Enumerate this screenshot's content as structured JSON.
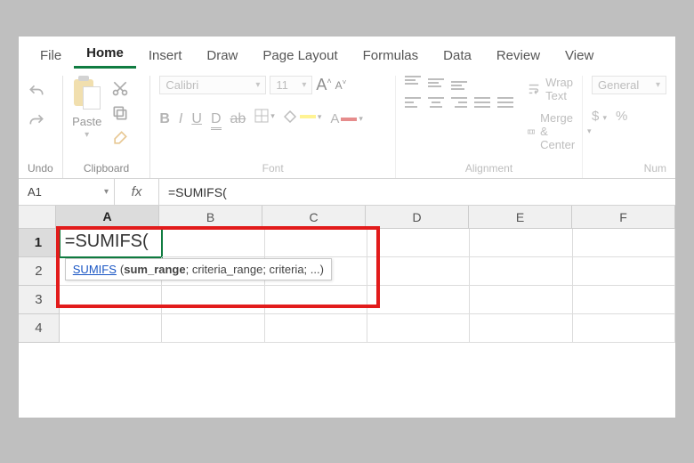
{
  "tabs": {
    "file": "File",
    "home": "Home",
    "insert": "Insert",
    "draw": "Draw",
    "page_layout": "Page Layout",
    "formulas": "Formulas",
    "data": "Data",
    "review": "Review",
    "view": "View"
  },
  "ribbon": {
    "undo_label": "Undo",
    "clipboard": {
      "paste": "Paste",
      "label": "Clipboard"
    },
    "font": {
      "label": "Font",
      "name": "Calibri",
      "size": "11",
      "bold": "B",
      "italic": "I",
      "underline": "U",
      "dunder": "D",
      "strike": "ab"
    },
    "alignment": {
      "label": "Alignment",
      "wrap": "Wrap Text",
      "merge": "Merge & Center"
    },
    "number": {
      "label": "Num",
      "format": "General",
      "currency": "$",
      "percent": "%"
    }
  },
  "namebox": {
    "ref": "A1"
  },
  "formula_bar": {
    "fx": "fx",
    "value": "=SUMIFS("
  },
  "columns": [
    "A",
    "B",
    "C",
    "D",
    "E",
    "F"
  ],
  "rows": [
    "1",
    "2",
    "3",
    "4"
  ],
  "cell_edit": {
    "text": "=SUMIFS("
  },
  "tooltip": {
    "fn": "SUMIFS",
    "sig_bold": "sum_range",
    "sig_rest": "; criteria_range; criteria; ..."
  }
}
